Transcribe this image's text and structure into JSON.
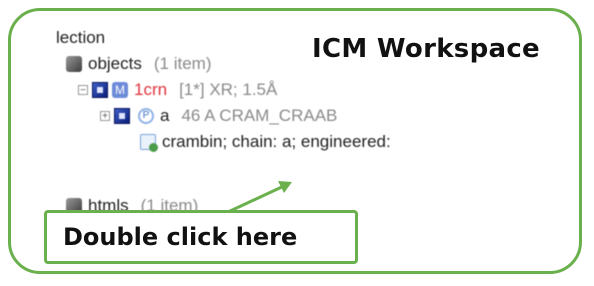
{
  "workspace": {
    "title": "ICM Workspace",
    "section_label": "lection",
    "objects": {
      "label": "objects",
      "count": "(1 item)"
    },
    "molecule": {
      "name": "1crn",
      "info": "[1*] XR; 1.5Å"
    },
    "chain": {
      "name": "a",
      "info": "46 A  CRAM_CRAAB"
    },
    "description": "crambin; chain: a; engineered:",
    "htmls": {
      "label": "htmls",
      "count": "(1 item)"
    }
  },
  "callout": {
    "text": "Double click here"
  },
  "colors": {
    "accent": "#6ab04c",
    "molecule": "#e0323c"
  }
}
